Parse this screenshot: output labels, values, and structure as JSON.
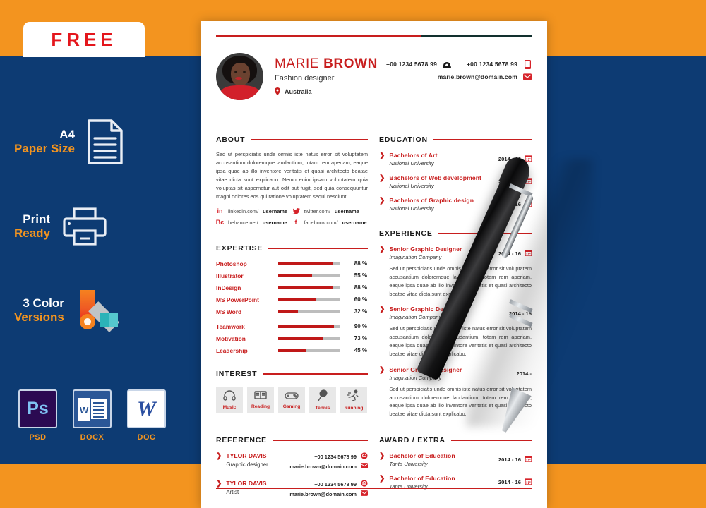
{
  "promo": {
    "free_label": "FREE",
    "features": [
      {
        "line1": "A4",
        "line2": "Paper Size",
        "icon": "document-icon"
      },
      {
        "line1": "Print",
        "line2": "Ready",
        "icon": "printer-icon"
      },
      {
        "line1": "3 Color",
        "line2": "Versions",
        "icon": "color-swatch-icon"
      }
    ],
    "formats": [
      {
        "caption": "PSD",
        "glyph": "Ps",
        "icon": "photoshop-icon"
      },
      {
        "caption": "DOCX",
        "glyph": "W",
        "icon": "word-docx-icon"
      },
      {
        "caption": "DOC",
        "glyph": "W",
        "icon": "word-doc-icon"
      }
    ],
    "colors": {
      "orange": "#F3941F",
      "navy": "#0D3B73",
      "red": "#E4161C"
    }
  },
  "resume": {
    "accent_red": "#C81E1E",
    "header": {
      "first_name": "MARIE",
      "last_name": "BROWN",
      "role": "Fashion designer",
      "location": "Australia",
      "phone1": "+00 1234 5678 99",
      "phone2": "+00 1234 5678 99",
      "email": "marie.brown@domain.com"
    },
    "about": {
      "title": "ABOUT",
      "text": "Sed ut perspiciatis unde omnis iste natus error sit voluptatem accusantium doloremque laudantium, totam rem aperiam, eaque ipsa quae ab illo inventore veritatis et quasi architecto beatae vitae dicta sunt explicabo. Nemo enim ipsam voluptatem quia voluptas sit aspernatur aut odit aut fugit, sed quia consequuntur magni dolores eos qui ratione voluptatem sequi nesciunt.",
      "socials": [
        {
          "icon": "linkedin-icon",
          "glyph": "in",
          "prefix": "linkedin.com/",
          "handle": "username"
        },
        {
          "icon": "twitter-icon",
          "glyph": "ᵛ",
          "prefix": "twitter.com/",
          "handle": "username"
        },
        {
          "icon": "behance-icon",
          "glyph": "Bє",
          "prefix": "behance.net/",
          "handle": "username"
        },
        {
          "icon": "facebook-icon",
          "glyph": "f",
          "prefix": "facebook.com/",
          "handle": "username"
        }
      ]
    },
    "education": {
      "title": "EDUCATION",
      "items": [
        {
          "degree": "Bachelors of Art",
          "school": "National University",
          "date": "2014 - 16"
        },
        {
          "degree": "Bachelors of Web development",
          "school": "National University",
          "date": "2014 - 16"
        },
        {
          "degree": "Bachelors of Graphic design",
          "school": "National University",
          "date": "2014 - 16"
        }
      ]
    },
    "expertise": {
      "title": "EXPERTISE",
      "group1": [
        {
          "name": "Photoshop",
          "percent": 88,
          "label": "88 %"
        },
        {
          "name": "Illustrator",
          "percent": 55,
          "label": "55 %"
        },
        {
          "name": "InDesign",
          "percent": 88,
          "label": "88 %"
        },
        {
          "name": "MS PowerPoint",
          "percent": 60,
          "label": "60 %"
        },
        {
          "name": "MS Word",
          "percent": 32,
          "label": "32 %"
        }
      ],
      "group2": [
        {
          "name": "Teamwork",
          "percent": 90,
          "label": "90 %"
        },
        {
          "name": "Motivation",
          "percent": 73,
          "label": "73 %"
        },
        {
          "name": "Leadership",
          "percent": 45,
          "label": "45 %"
        }
      ]
    },
    "experience": {
      "title": "EXPERIENCE",
      "items": [
        {
          "role": "Senior Graphic Designer",
          "company": "Imagination Company",
          "date": "2014 - 16",
          "text": "Sed ut perspiciatis unde omnis iste natus error sit voluptatem accusantium doloremque laudantium, totam rem aperiam, eaque ipsa quae ab illo inventore veritatis et quasi architecto beatae vitae dicta sunt explicabo."
        },
        {
          "role": "Senior Graphic Designer",
          "company": "Imagination Company",
          "date": "2014 - 16",
          "text": "Sed ut perspiciatis unde omnis iste natus error sit voluptatem accusantium doloremque laudantium, totam rem aperiam, eaque ipsa quae ab illo inventore veritatis et quasi architecto beatae vitae dicta sunt explicabo."
        },
        {
          "role": "Senior Graphic Designer",
          "company": "Imagination Company",
          "date": "2014 -",
          "text": "Sed ut perspiciatis unde omnis iste natus error sit voluptatem accusantium doloremque laudantium, totam rem aperiam, eaque ipsa quae ab illo inventore veritatis et quasi architecto beatae vitae dicta sunt explicabo."
        }
      ]
    },
    "interest": {
      "title": "INTEREST",
      "items": [
        {
          "label": "Music",
          "icon": "headphones-icon"
        },
        {
          "label": "Reading",
          "icon": "book-icon"
        },
        {
          "label": "Gaming",
          "icon": "gamepad-icon"
        },
        {
          "label": "Tennis",
          "icon": "racket-icon"
        },
        {
          "label": "Running",
          "icon": "runner-icon"
        }
      ]
    },
    "reference": {
      "title": "REFERENCE",
      "items": [
        {
          "name": "TYLOR DAVIS",
          "role": "Graphic designer",
          "phone": "+00 1234 5678 99",
          "email": "marie.brown@domain.com"
        },
        {
          "name": "TYLOR DAVIS",
          "role": "Artist",
          "phone": "+00 1234 5678 99",
          "email": "marie.brown@domain.com"
        }
      ]
    },
    "award": {
      "title": "AWARD / EXTRA",
      "items": [
        {
          "degree": "Bachelor of Education",
          "school": "Tanta University",
          "date": "2014 - 16"
        },
        {
          "degree": "Bachelor of Education",
          "school": "Tanta University",
          "date": "2014 - 16"
        }
      ]
    }
  }
}
